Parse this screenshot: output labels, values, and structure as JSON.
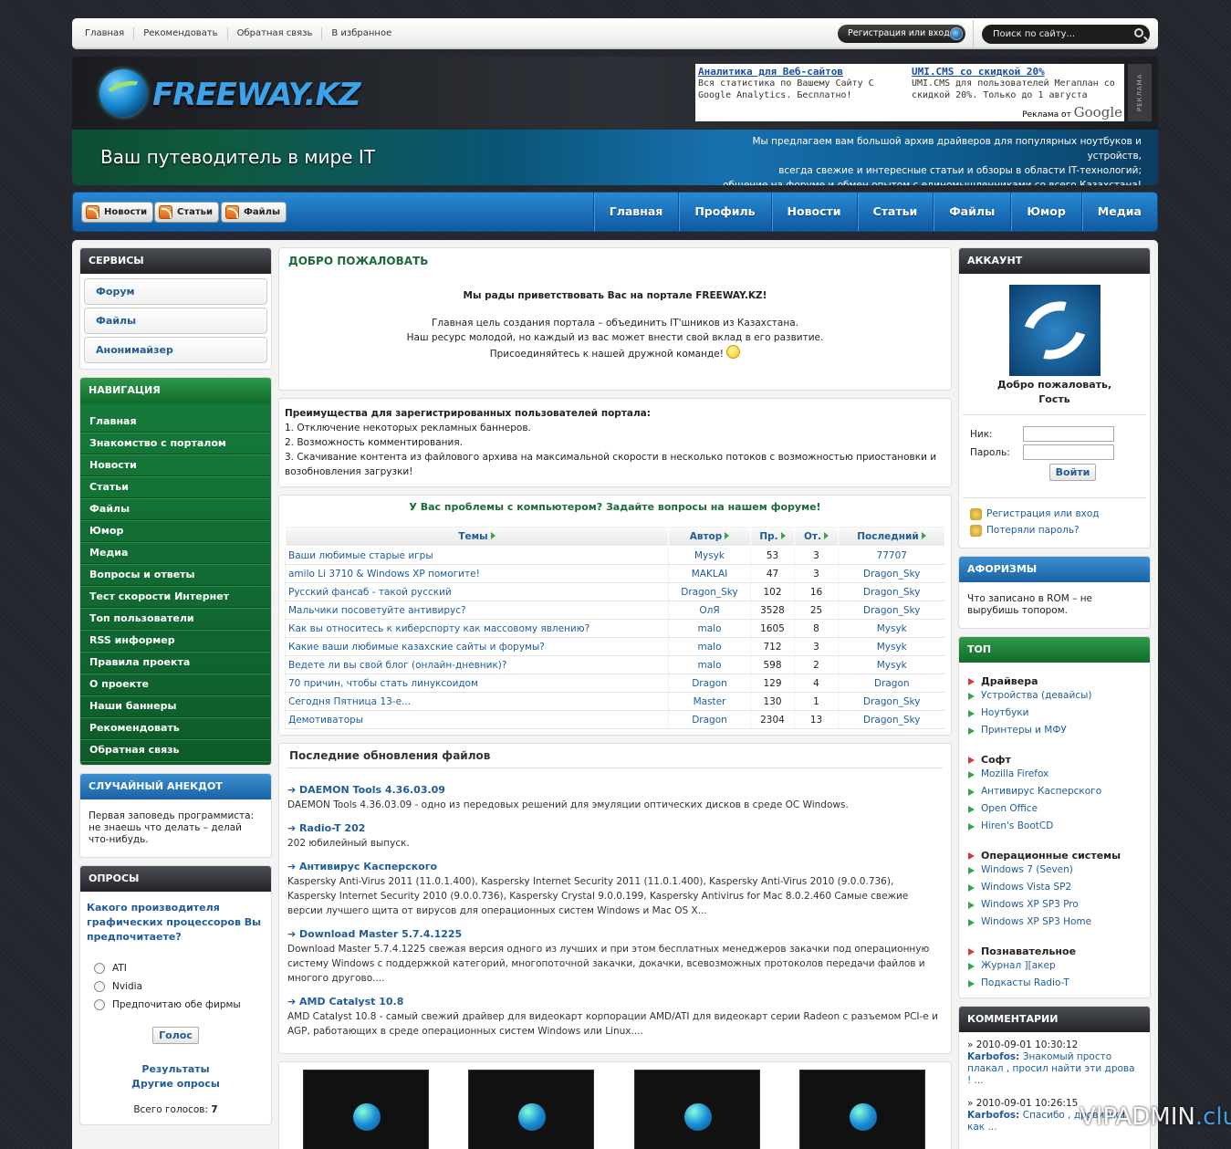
{
  "topbar": {
    "links": [
      "Главная",
      "Рекомендовать",
      "Обратная связь",
      "В избранное"
    ],
    "register_label": "Регистрация или вход",
    "search_placeholder": "Поиск по сайту..."
  },
  "header": {
    "logo_text": "FREEWAY.KZ",
    "ad": {
      "col1_title": "Аналитика для Веб-сайтов",
      "col1_text": "Вся статистика по Вашему Сайту С Google Analytics. Бесплатно!",
      "col2_title": "UMI.CMS со скидкой 20%",
      "col2_text": "UMI.CMS для пользователей Мегаплан со скидкой 20%. Только до 1 августа",
      "footer_label": "Реклама от",
      "footer_brand": "Google",
      "side_label": "РЕКЛАМА"
    }
  },
  "banner": {
    "slogan": "Ваш путеводитель в мире IT",
    "desc1": "Мы предлагаем вам большой архив драйверов для популярных ноутбуков и устройств,",
    "desc2": "всегда свежие и интересные статьи и обзоры в области IT-технологий;",
    "desc3": "общение на форуме и обмен опытом с единомышленниками со всего Казахстана!"
  },
  "navbar": {
    "rss": [
      "Новости",
      "Статьи",
      "Файлы"
    ],
    "main": [
      "Главная",
      "Профиль",
      "Новости",
      "Статьи",
      "Файлы",
      "Юмор",
      "Медиа"
    ]
  },
  "left": {
    "services_title": "Сервисы",
    "services": [
      "Форум",
      "Файлы",
      "Анонимайзер"
    ],
    "nav_title": "Навигация",
    "nav": [
      "Главная",
      "Знакомство с порталом",
      "Новости",
      "Статьи",
      "Файлы",
      "Юмор",
      "Медиа",
      "Вопросы и ответы",
      "Тест скорости Интернет",
      "Топ пользователи",
      "RSS информер",
      "Правила проекта",
      "О проекте",
      "Наши баннеры",
      "Рекомендовать",
      "Обратная связь"
    ],
    "joke_title": "Случайный анекдот",
    "joke_text": "Первая заповедь программиста: не знаешь что делать – делай что-нибудь.",
    "poll_title": "Опросы",
    "poll_question": "Какого производителя графических процессоров Вы предпочитаете?",
    "poll_options": [
      "ATI",
      "Nvidia",
      "Предпочитаю обе фирмы"
    ],
    "vote_label": "Голос",
    "results_label": "Результаты",
    "other_polls_label": "Другие опросы",
    "total_label": "Всего голосов:",
    "total_value": "7"
  },
  "welcome": {
    "title": "ДОБРО ПОЖАЛОВАТЬ",
    "line1": "Мы рады приветствовать Вас на портале FREEWAY.KZ!",
    "line2": "Главная цель создания портала – объединить IT'шников из Казахстана.",
    "line3": "Наш ресурс молодой, но каждый из вас может внести свой вклад в его развитие.",
    "line4": "Присоединяйтесь к нашей дружной команде!"
  },
  "advantages": {
    "title": "Преимущества для зарегистрированных пользователей портала:",
    "items": [
      "1. Отключение некоторых рекламных баннеров.",
      "2. Возможность комментирования.",
      "3. Скачивание контента из файлового архива на максимальной скорости в несколько потоков с возможностью приостановки и возобновления загрузки!"
    ]
  },
  "forum": {
    "title": "У Вас проблемы с компьютером? Задайте вопросы на нашем форуме!",
    "headers": [
      "Темы",
      "Автор",
      "Пр.",
      "От.",
      "Последний"
    ],
    "rows": [
      [
        "Ваши любимые старые игры",
        "Mysyk",
        "53",
        "3",
        "77707"
      ],
      [
        "amilo Li 3710 & Windows XP помогите!",
        "MAKLAI",
        "47",
        "3",
        "Dragon_Sky"
      ],
      [
        "Русский фансаб - такой русский",
        "Dragon_Sky",
        "102",
        "16",
        "Dragon_Sky"
      ],
      [
        "Мальчики посоветуйте антивирус?",
        "ОлЯ",
        "3528",
        "25",
        "Dragon_Sky"
      ],
      [
        "Как вы относитесь к киберспорту как массовому явлению?",
        "malo",
        "1605",
        "8",
        "Mysyk"
      ],
      [
        "Какие ваши любимые казахские сайты и форумы?",
        "malo",
        "712",
        "3",
        "Mysyk"
      ],
      [
        "Ведете ли вы свой блог (онлайн-дневник)?",
        "malo",
        "598",
        "2",
        "Mysyk"
      ],
      [
        "70 причин, чтобы стать линуксоидом",
        "Dragon",
        "129",
        "4",
        "Dragon"
      ],
      [
        "Сегодня Пятница 13-е...",
        "Master",
        "130",
        "1",
        "Dragon_Sky"
      ],
      [
        "Демотиваторы",
        "Dragon",
        "2304",
        "13",
        "Dragon_Sky"
      ]
    ]
  },
  "files": {
    "title": "Последние обновления файлов",
    "items": [
      {
        "title": "DAEMON Tools 4.36.03.09",
        "text": "DAEMON Tools 4.36.03.09 - одно из передовых решений для эмуляции оптических дисков в среде ОС Windows."
      },
      {
        "title": "Radio-T 202",
        "text": "202 юбилейный выпуск."
      },
      {
        "title": "Антивирус Касперского",
        "text": "Kaspersky Anti-Virus 2011 (11.0.1.400), Kaspersky Internet Security 2011 (11.0.1.400), Kaspersky Anti-Virus 2010 (9.0.0.736), Kaspersky Internet Security 2010 (9.0.0.736), Kaspersky Crystal 9.0.0.199, Kaspersky Antivirus for Mac 8.0.2.460 Самые свежие версии лучшего щита от вирусов для операционных систем Windows и Mac OS X..."
      },
      {
        "title": "Download Master 5.7.4.1225",
        "text": "Download Master 5.7.4.1225 свежая версия одного из лучших и при этом бесплатных менеджеров закачки под операционную систему Windows с поддержкой категорий, многопоточной закачки, докачки, всевозможных протоколов передачи файлов и многого другово...."
      },
      {
        "title": "AMD Catalyst 10.8",
        "text": "AMD Catalyst 10.8 - самый свежий драйвер для видеокарт корпорации AMD/ATI для видеокарт серии Radeon с разъемом PCI-e и AGP, работающих в среде операционных систем Windows или Linux...."
      }
    ]
  },
  "account": {
    "title": "Аккаунт",
    "greeting1": "Добро пожаловать,",
    "greeting2": "Гость",
    "login_label": "Ник:",
    "password_label": "Пароль:",
    "login_button": "Войти",
    "register_link": "Регистрация или вход",
    "lost_password_link": "Потеряли пароль?"
  },
  "aphorism": {
    "title": "Афоризмы",
    "text": "Что записано в ROM – не вырубишь топором."
  },
  "top": {
    "title": "Топ",
    "sections": [
      {
        "name": "Драйвера",
        "items": [
          "Устройства (девайсы)",
          "Ноутбуки",
          "Принтеры и МФУ"
        ]
      },
      {
        "name": "Софт",
        "items": [
          "Mozilla Firefox",
          "Антивирус Касперского",
          "Open Office",
          "Hiren's BootCD"
        ]
      },
      {
        "name": "Операционные системы",
        "items": [
          "Windows 7 (Seven)",
          "Windows Vista SP2",
          "Windows XP SP3 Pro",
          "Windows XP SP3 Home"
        ]
      },
      {
        "name": "Познавательное",
        "items": [
          "Журнал ][акер",
          "Подкасты Radio-T"
        ]
      }
    ]
  },
  "comments": {
    "title": "Комментарии",
    "items": [
      {
        "date": "» 2010-09-01 10:30:12",
        "author": "Karbofos:",
        "text": "Знакомый просто плакал , просил найти эти дрова ! ..."
      },
      {
        "date": "» 2010-09-01 10:26:15",
        "author": "Karbofos:",
        "text": "Спасибо , дровишки как ..."
      }
    ]
  },
  "watermark": {
    "part1": "VIPADMIN",
    "part2": ".club"
  }
}
